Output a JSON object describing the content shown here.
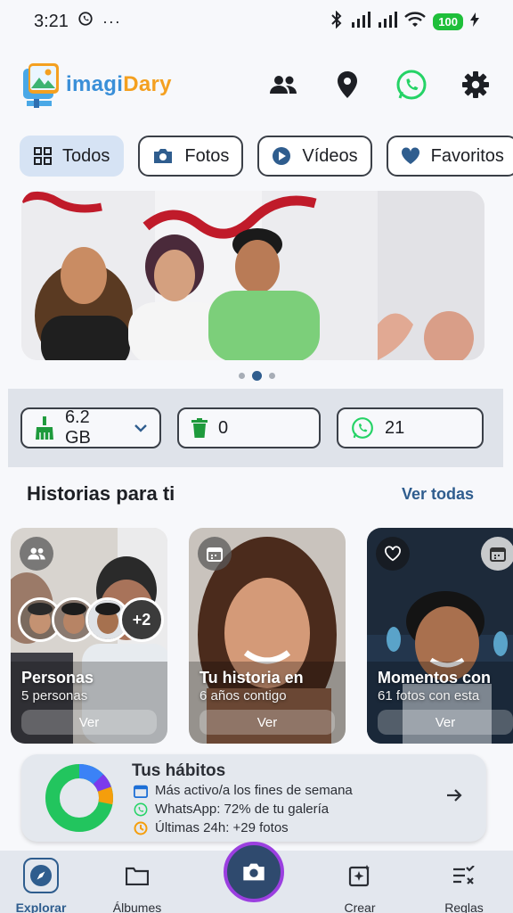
{
  "status_bar": {
    "time": "3:21",
    "more": "···",
    "battery": "100"
  },
  "app": {
    "logo_main": "imagi",
    "logo_tail": "Dary"
  },
  "filters": [
    {
      "label": "Todos",
      "icon": "grid-icon",
      "active": true
    },
    {
      "label": "Fotos",
      "icon": "camera-icon",
      "active": false
    },
    {
      "label": "Vídeos",
      "icon": "play-icon",
      "active": false
    },
    {
      "label": "Favoritos",
      "icon": "heart-icon",
      "active": false
    }
  ],
  "banner": {
    "carousel_pages": 3,
    "carousel_active": 2
  },
  "storage": {
    "cleanup_size": "6.2 GB",
    "trash_count": "0",
    "whatsapp_count": "21"
  },
  "stories_section": {
    "title": "Historias para ti",
    "see_all": "Ver todas",
    "items": [
      {
        "title": "Personas",
        "subtitle": "5 personas",
        "button": "Ver",
        "more_count": "+2"
      },
      {
        "title": "Tu historia en",
        "subtitle": "6 años contigo",
        "button": "Ver"
      },
      {
        "title": "Momentos con",
        "subtitle": "61 fotos con esta",
        "button": "Ver"
      }
    ]
  },
  "habits": {
    "title": "Tus hábitos",
    "lines": [
      "Más activo/a los fines de semana",
      "WhatsApp: 72% de tu galería",
      "Últimas 24h: +29 fotos"
    ],
    "whatsapp_share": 0.72,
    "colors": {
      "whatsapp": "#22c55e",
      "other1": "#3b82f6",
      "other2": "#7c3aed",
      "other3": "#f59e0b"
    }
  },
  "bottom_nav": [
    {
      "label": "Explorar",
      "active": true
    },
    {
      "label": "Álbumes",
      "active": false
    },
    {
      "label": "Crear",
      "active": false
    },
    {
      "label": "Reglas",
      "active": false
    }
  ],
  "colors": {
    "accent": "#2f5d8e",
    "chip_active": "#d6e3f4",
    "whatsapp": "#25d366",
    "fab_ring": "#9b3fe0"
  }
}
